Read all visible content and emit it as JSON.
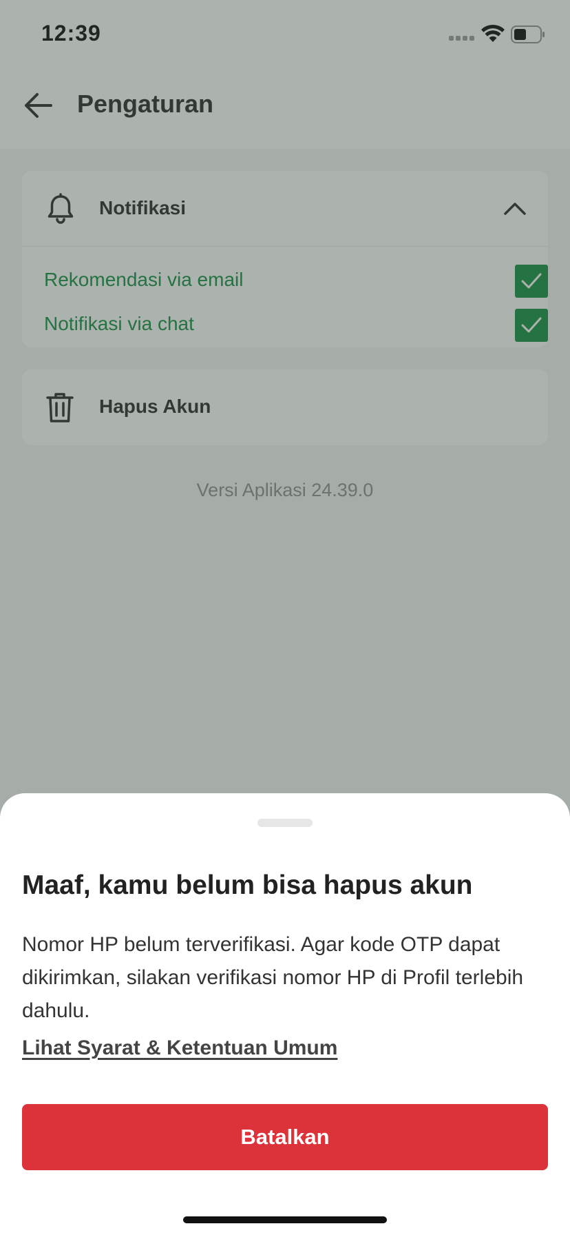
{
  "status_bar": {
    "time": "12:39",
    "icons": [
      "signal-icon",
      "wifi-icon",
      "battery-icon"
    ]
  },
  "header": {
    "back_icon": "arrow-left-icon",
    "title": "Pengaturan"
  },
  "notifications": {
    "icon": "bell-icon",
    "label": "Notifikasi",
    "expanded": true,
    "options": [
      {
        "label": "Rekomendasi via email",
        "checked": true
      },
      {
        "label": "Notifikasi via chat",
        "checked": true
      }
    ]
  },
  "delete_account": {
    "icon": "trash-icon",
    "label": "Hapus Akun"
  },
  "app_version": "Versi Aplikasi 24.39.0",
  "sheet": {
    "title": "Maaf, kamu belum bisa hapus akun",
    "message": "Nomor HP belum terverifikasi. Agar kode OTP dapat dikirimkan, silakan verifikasi nomor HP di Profil terlebih dahulu.",
    "terms_link": "Lihat Syarat & Ketentuan Umum",
    "cancel_button": "Batalkan"
  },
  "colors": {
    "accent_green": "#0a8a3c",
    "danger_red": "#dc3239",
    "overlay": "#46544a"
  }
}
